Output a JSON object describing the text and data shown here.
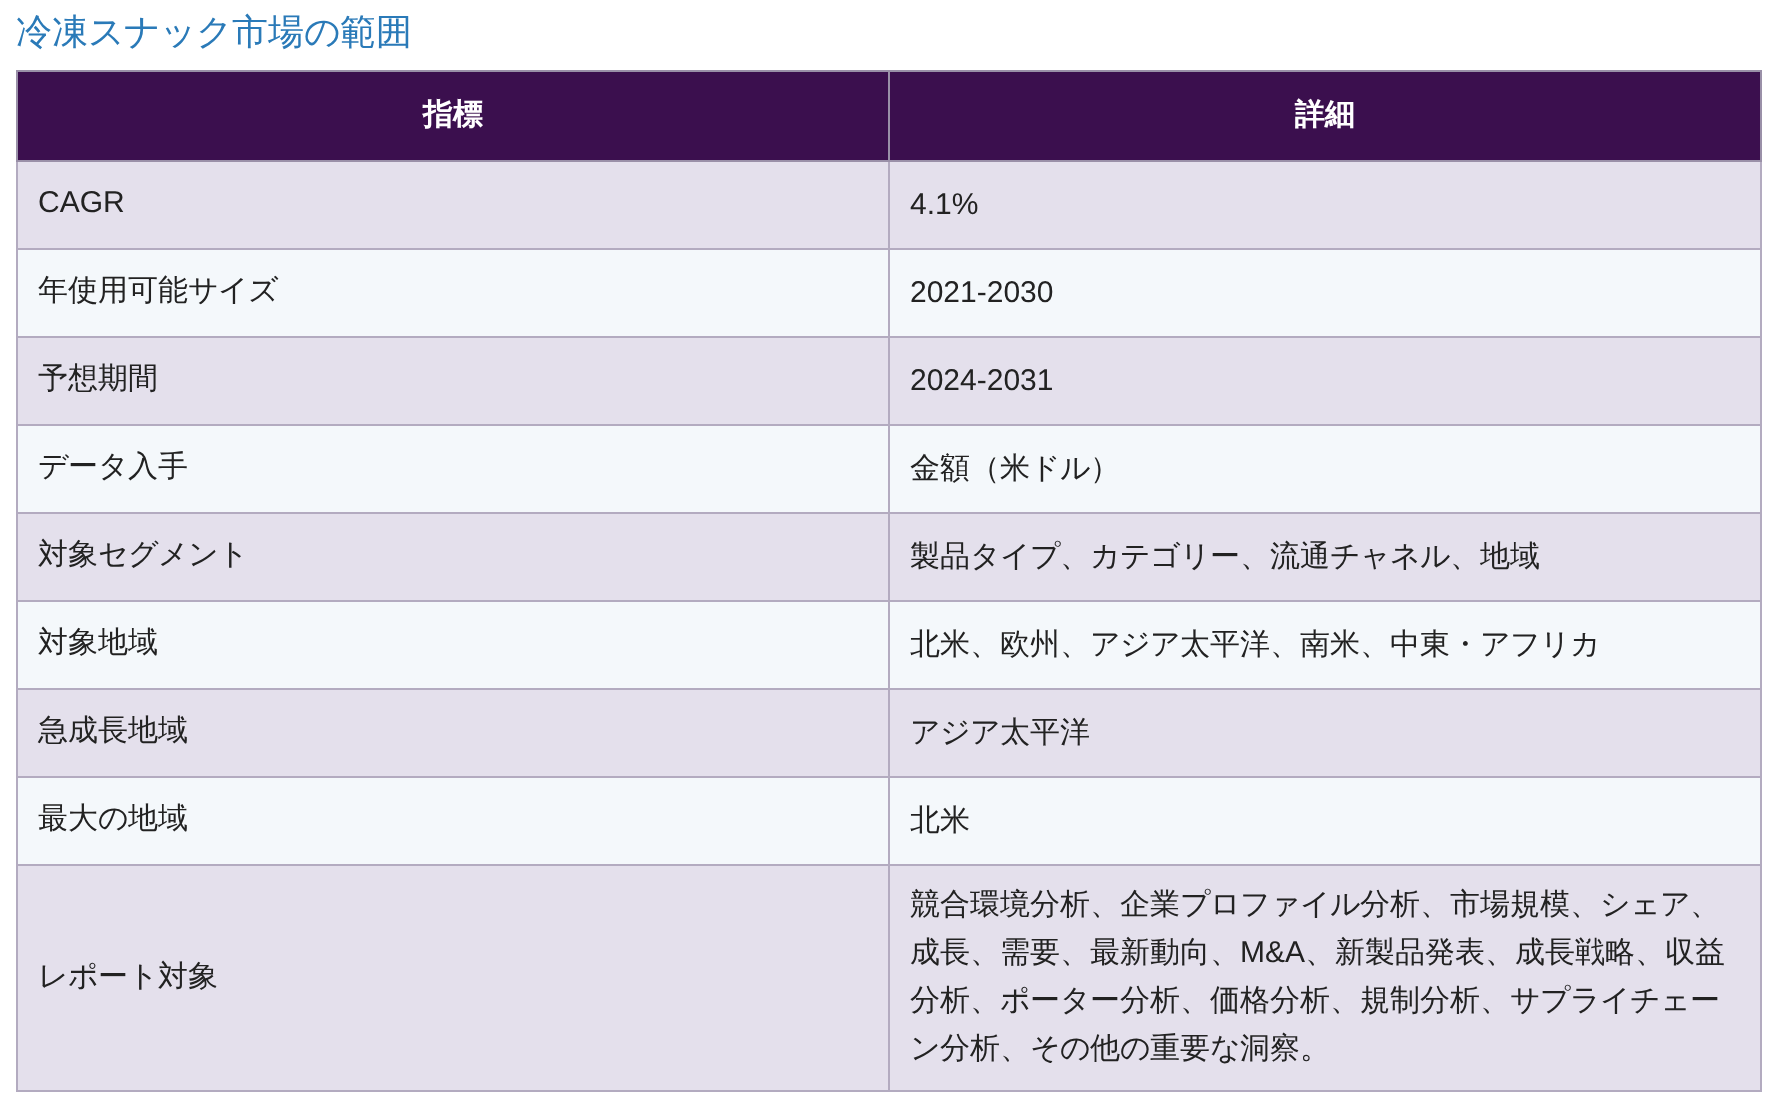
{
  "title": "冷凍スナック市場の範囲",
  "table": {
    "columns": [
      "指標",
      "詳細"
    ],
    "rows": [
      {
        "label": "CAGR",
        "value": "4.1%"
      },
      {
        "label": "年使用可能サイズ",
        "value": "2021-2030"
      },
      {
        "label": "予想期間",
        "value": "2024-2031"
      },
      {
        "label": "データ入手",
        "value": "金額（米ドル）"
      },
      {
        "label": "対象セグメント",
        "value": "製品タイプ、カテゴリー、流通チャネル、地域"
      },
      {
        "label": "対象地域",
        "value": "北米、欧州、アジア太平洋、南米、中東・アフリカ"
      },
      {
        "label": "急成長地域",
        "value": "アジア太平洋"
      },
      {
        "label": "最大の地域",
        "value": "北米"
      },
      {
        "label": "レポート対象",
        "value": "競合環境分析、企業プロファイル分析、市場規模、シェア、成長、需要、最新動向、M&A、新製品発表、成長戦略、収益分析、ポーター分析、価格分析、規制分析、サプライチェーン分析、その他の重要な洞察。"
      }
    ]
  }
}
